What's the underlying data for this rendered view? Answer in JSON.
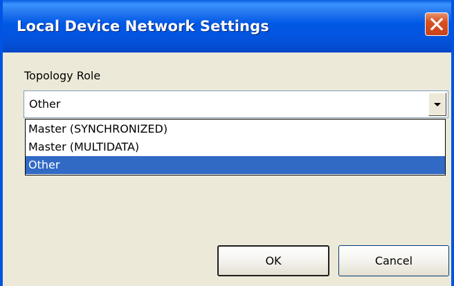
{
  "window": {
    "title": "Local Device Network Settings",
    "close_icon": "close-icon"
  },
  "form": {
    "topology_label": "Topology Role",
    "topology_select": {
      "value": "Other",
      "options": [
        "Master (SYNCHRONIZED)",
        "Master (MULTIDATA)",
        "Other"
      ],
      "selected_index": 2,
      "expanded": true
    }
  },
  "buttons": {
    "ok_label": "OK",
    "cancel_label": "Cancel"
  },
  "colors": {
    "titlebar": "#0058e6",
    "dialog_background": "#ece9d8",
    "selection_highlight": "#316ac5",
    "close_button": "#d9501f"
  }
}
